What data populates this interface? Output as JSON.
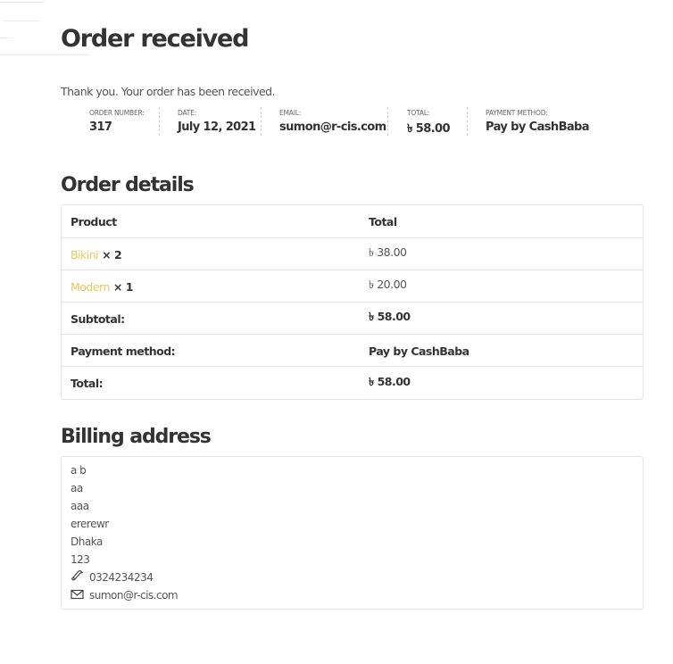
{
  "page": {
    "title": "Order received",
    "thanks": "Thank you. Your order has been received."
  },
  "overview": {
    "order_number": {
      "label": "ORDER NUMBER:",
      "value": "317"
    },
    "date": {
      "label": "DATE:",
      "value": "July 12, 2021"
    },
    "email": {
      "label": "EMAIL:",
      "value": "sumon@r-cis.com"
    },
    "total": {
      "label": "TOTAL:",
      "value": "৳ 58.00"
    },
    "payment": {
      "label": "PAYMENT METHOD:",
      "value": "Pay by CashBaba"
    }
  },
  "order_details": {
    "title": "Order details",
    "headers": {
      "product": "Product",
      "total": "Total"
    },
    "items": [
      {
        "name": "Bikini",
        "qty": "× 2",
        "total": "৳ 38.00"
      },
      {
        "name": "Modern",
        "qty": "× 1",
        "total": "৳ 20.00"
      }
    ],
    "subtotal": {
      "label": "Subtotal:",
      "value": "৳ 58.00"
    },
    "payment_method": {
      "label": "Payment method:",
      "value": "Pay by CashBaba"
    },
    "total": {
      "label": "Total:",
      "value": "৳ 58.00"
    }
  },
  "billing": {
    "title": "Billing address",
    "lines": [
      "a b",
      "aa",
      "aaa",
      "ererewr",
      "Dhaka",
      "123"
    ],
    "phone": "0324234234",
    "email": "sumon@r-cis.com"
  },
  "icons": {
    "phone": "phone-icon",
    "email": "envelope-icon"
  },
  "colors": {
    "product_link": "#f0c55a",
    "border": "#e3e3e3",
    "text": "#333333"
  }
}
